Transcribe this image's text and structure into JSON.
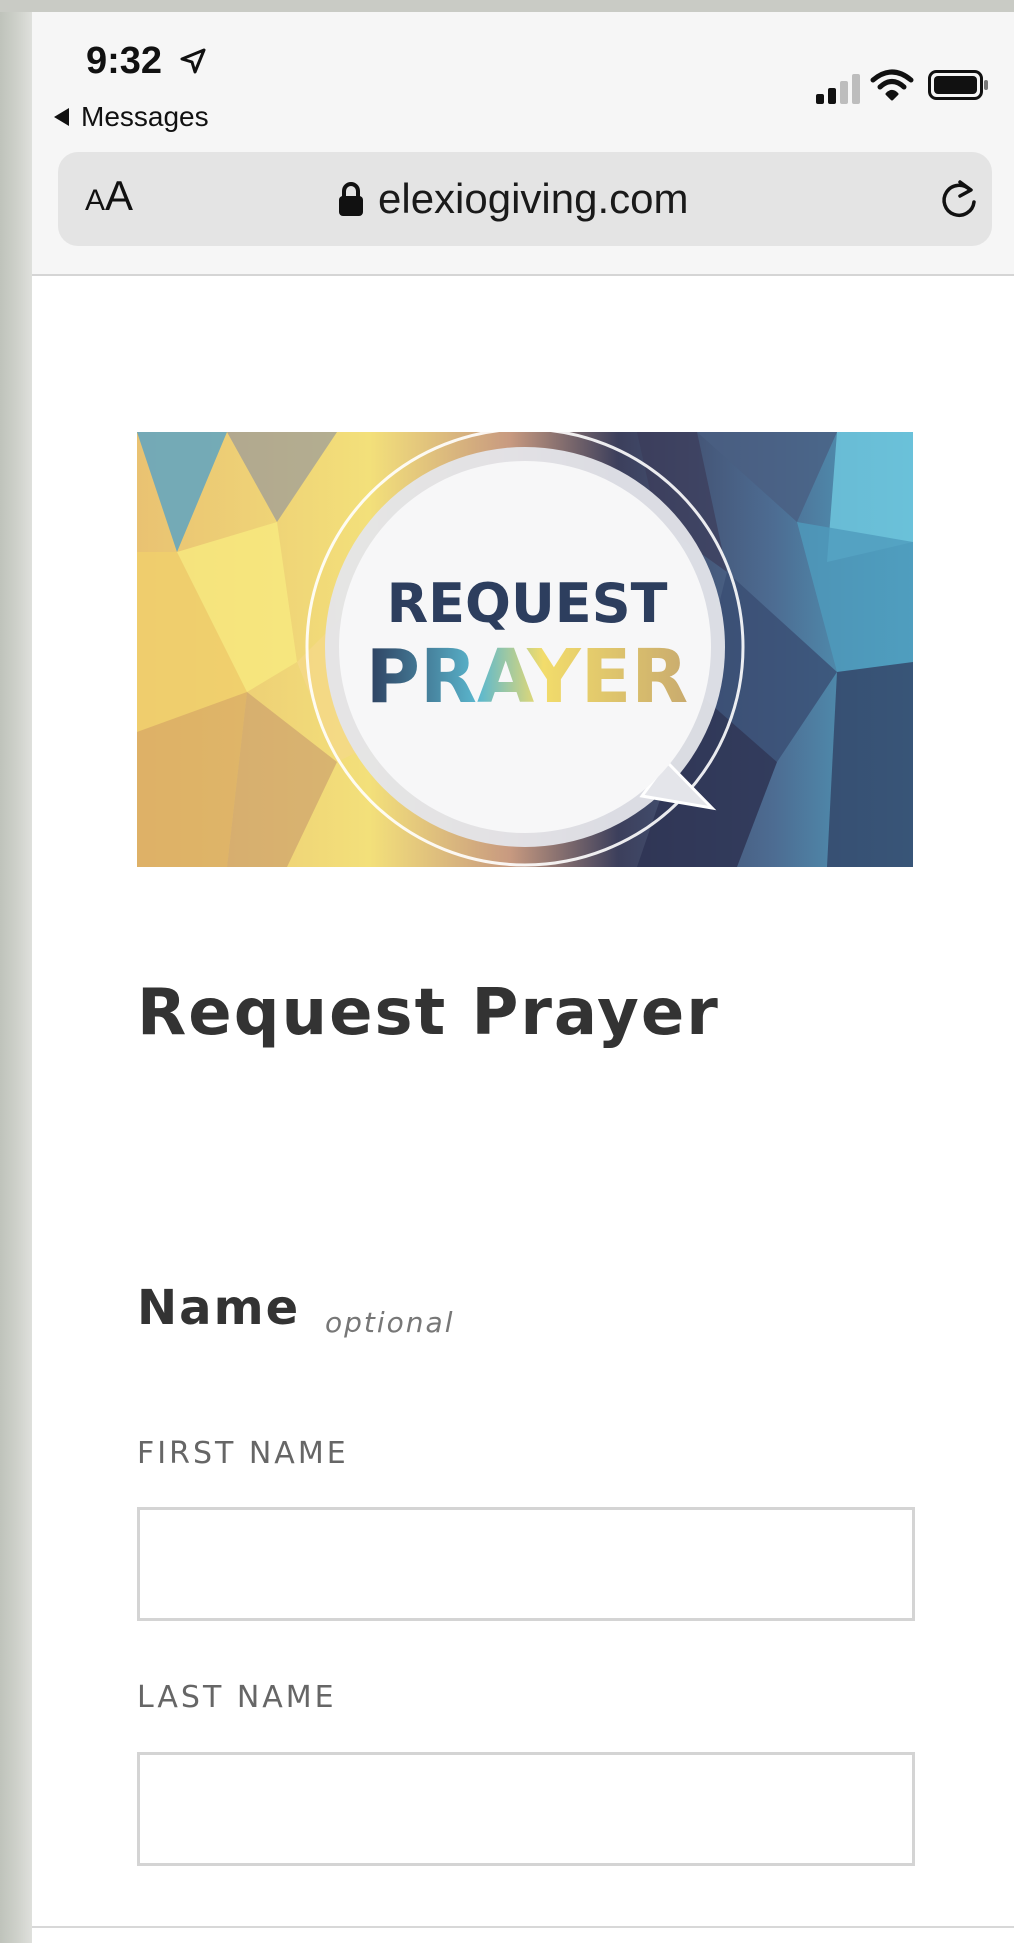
{
  "status_bar": {
    "time": "9:32",
    "back_label": "Messages"
  },
  "browser": {
    "aa_small": "A",
    "aa_big": "A",
    "url": "elexiogiving.com"
  },
  "banner": {
    "line1": "REQUEST",
    "line2_letters": [
      "P",
      "R",
      "A",
      "Y",
      "E",
      "R"
    ]
  },
  "page": {
    "title": "Request Prayer"
  },
  "form": {
    "name_heading": "Name",
    "name_hint": "optional",
    "first_name_label": "FIRST NAME",
    "first_name_value": "",
    "last_name_label": "LAST NAME",
    "last_name_value": ""
  },
  "colors": {
    "heading_text": "#333333",
    "label_text": "#666666",
    "input_border": "#d4d4d4",
    "banner_navy": "#2d3e5e",
    "banner_yellow": "#f2dc6b",
    "banner_teal": "#5bb8cf"
  }
}
